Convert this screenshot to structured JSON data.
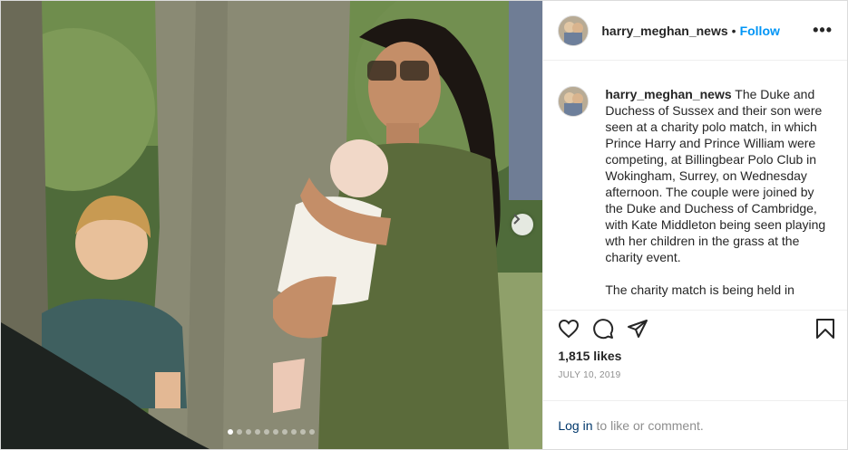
{
  "post": {
    "username": "harry_meghan_news",
    "separator": "•",
    "follow_label": "Follow",
    "more_label": "•••",
    "caption_paragraphs": [
      "The Duke and Duchess of Sussex and their son were seen at a charity polo match, in which Prince Harry and Prince William were competing, at Billingbear Polo Club in Wokingham, Surrey, on Wednesday afternoon. The couple were joined by the Duke and Duchess of Cambridge, with Kate Middleton being seen playing wth her children in the grass at the charity event.",
      "The charity match is being held in"
    ],
    "likes_text": "1,815 likes",
    "date_text": "JULY 10, 2019",
    "login_link": "Log in",
    "login_rest": "to like or comment.",
    "carousel": {
      "total_slides": 10,
      "current_index": 0
    }
  },
  "icons": {
    "like": "heart-icon",
    "comment": "comment-icon",
    "share": "paper-plane-icon",
    "save": "bookmark-icon",
    "next": "chevron-right-icon"
  },
  "colors": {
    "link": "#0095f6",
    "text": "#262626",
    "muted": "#8e8e8e"
  }
}
